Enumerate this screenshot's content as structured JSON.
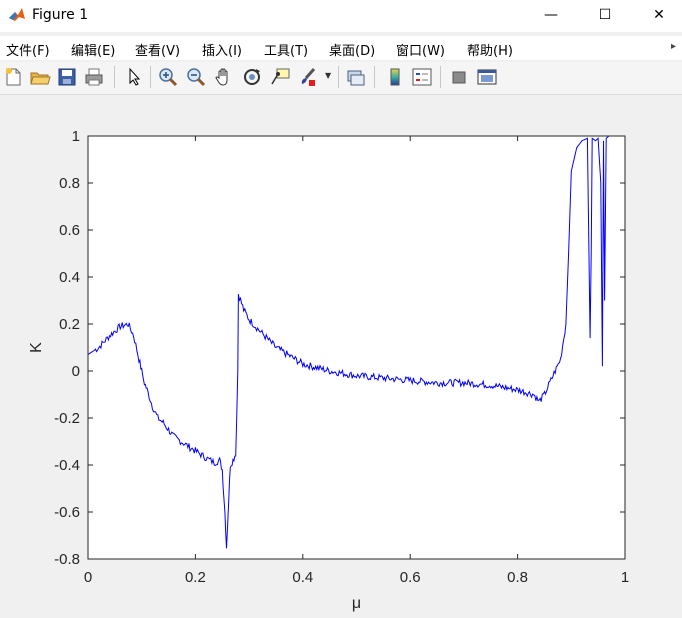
{
  "window": {
    "title": "Figure 1",
    "minimize": "—",
    "maximize": "☐",
    "close": "✕"
  },
  "menubar": {
    "items": [
      {
        "label": "文件(F)"
      },
      {
        "label": "编辑(E)"
      },
      {
        "label": "查看(V)"
      },
      {
        "label": "插入(I)"
      },
      {
        "label": "工具(T)"
      },
      {
        "label": "桌面(D)"
      },
      {
        "label": "窗口(W)"
      },
      {
        "label": "帮助(H)"
      }
    ],
    "overflow_arrow": "▸"
  },
  "toolbar": {
    "icons": [
      "new-figure-icon",
      "open-file-icon",
      "save-icon",
      "print-icon",
      "arrow-pointer-icon",
      "zoom-in-icon",
      "zoom-out-icon",
      "pan-hand-icon",
      "rotate-3d-icon",
      "data-cursor-icon",
      "brush-icon",
      "link-plot-icon",
      "colorbar-icon",
      "legend-icon",
      "hide-plot-tools-icon",
      "show-plot-tools-icon"
    ]
  },
  "chart_data": {
    "type": "line",
    "xlabel": "μ",
    "ylabel": "K",
    "xlim": [
      0,
      1
    ],
    "ylim": [
      -0.8,
      1
    ],
    "xticks": [
      "0",
      "0.2",
      "0.4",
      "0.6",
      "0.8",
      "1"
    ],
    "yticks": [
      "-0.8",
      "-0.6",
      "-0.4",
      "-0.2",
      "0",
      "0.2",
      "0.4",
      "0.6",
      "0.8",
      "1"
    ],
    "grid": false,
    "line_color": "#0000ff",
    "series": [
      {
        "x": [
          0,
          0.02,
          0.04,
          0.06,
          0.075,
          0.085,
          0.095,
          0.1,
          0.105,
          0.11,
          0.12,
          0.13,
          0.14,
          0.15,
          0.16,
          0.18,
          0.2,
          0.22,
          0.235,
          0.245,
          0.25,
          0.255,
          0.258,
          0.262,
          0.265,
          0.27,
          0.275,
          0.277,
          0.279,
          0.28,
          0.29,
          0.3,
          0.32,
          0.35,
          0.4,
          0.45,
          0.5,
          0.55,
          0.6,
          0.65,
          0.7,
          0.75,
          0.8,
          0.83,
          0.84,
          0.85,
          0.86,
          0.87,
          0.88,
          0.89,
          0.895,
          0.9,
          0.905,
          0.91,
          0.92,
          0.93,
          0.935,
          0.937,
          0.939,
          0.945,
          0.95,
          0.955,
          0.958,
          0.96,
          0.962,
          0.965,
          0.97,
          0.98,
          1
        ],
        "y": [
          0.07,
          0.1,
          0.15,
          0.19,
          0.2,
          0.15,
          0.05,
          0.0,
          -0.05,
          -0.08,
          -0.15,
          -0.2,
          -0.22,
          -0.25,
          -0.28,
          -0.31,
          -0.34,
          -0.37,
          -0.39,
          -0.38,
          -0.42,
          -0.6,
          -0.75,
          -0.55,
          -0.4,
          -0.38,
          -0.35,
          -0.2,
          0.0,
          0.33,
          0.26,
          0.22,
          0.17,
          0.1,
          0.03,
          0.0,
          -0.02,
          -0.03,
          -0.04,
          -0.05,
          -0.05,
          -0.06,
          -0.08,
          -0.1,
          -0.13,
          -0.1,
          -0.05,
          0.0,
          0.05,
          0.2,
          0.5,
          0.85,
          0.9,
          0.95,
          0.98,
          0.99,
          0.14,
          0.5,
          0.99,
          0.98,
          0.99,
          0.8,
          0.02,
          0.98,
          0.3,
          0.99,
          1.0,
          1.0,
          1.0
        ]
      }
    ]
  }
}
